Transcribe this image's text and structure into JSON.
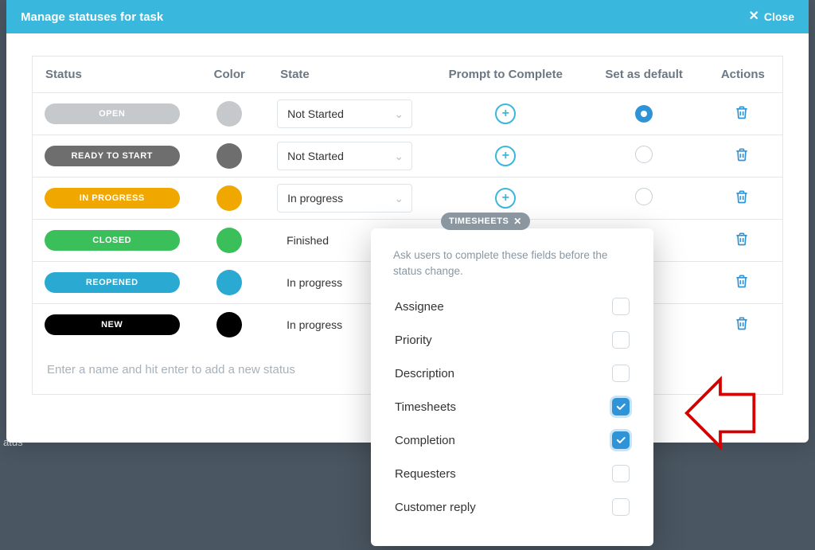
{
  "modal": {
    "title": "Manage statuses for task",
    "close_label": "Close"
  },
  "columns": {
    "status": "Status",
    "color": "Color",
    "state": "State",
    "prompt": "Prompt to Complete",
    "default": "Set as default",
    "actions": "Actions"
  },
  "rows": [
    {
      "label": "OPEN",
      "color": "#c5c9cc",
      "textColor": "#ffffff",
      "state": "Not Started",
      "hasChevron": true,
      "default": true
    },
    {
      "label": "READY TO START",
      "color": "#6e6e6e",
      "textColor": "#ffffff",
      "state": "Not Started",
      "hasChevron": true,
      "default": false
    },
    {
      "label": "IN PROGRESS",
      "color": "#f0a800",
      "textColor": "#ffffff",
      "state": "In progress",
      "hasChevron": true,
      "default": false
    },
    {
      "label": "CLOSED",
      "color": "#3bbf5b",
      "textColor": "#ffffff",
      "state": "Finished",
      "hasChevron": false,
      "default": false
    },
    {
      "label": "REOPENED",
      "color": "#2aa9d2",
      "textColor": "#ffffff",
      "state": "In progress",
      "hasChevron": false,
      "default": false
    },
    {
      "label": "NEW",
      "color": "#000000",
      "textColor": "#ffffff",
      "state": "In progress",
      "hasChevron": false,
      "default": false
    }
  ],
  "newStatus": {
    "placeholder": "Enter a name and hit enter to add a new status"
  },
  "chip": {
    "label": "TIMESHEETS"
  },
  "popover": {
    "desc": "Ask users to complete these fields before the status change.",
    "items": [
      {
        "label": "Assignee",
        "checked": false
      },
      {
        "label": "Priority",
        "checked": false
      },
      {
        "label": "Description",
        "checked": false
      },
      {
        "label": "Timesheets",
        "checked": true
      },
      {
        "label": "Completion",
        "checked": true
      },
      {
        "label": "Requesters",
        "checked": false
      },
      {
        "label": "Customer reply",
        "checked": false
      }
    ]
  },
  "bgHint": "atus"
}
